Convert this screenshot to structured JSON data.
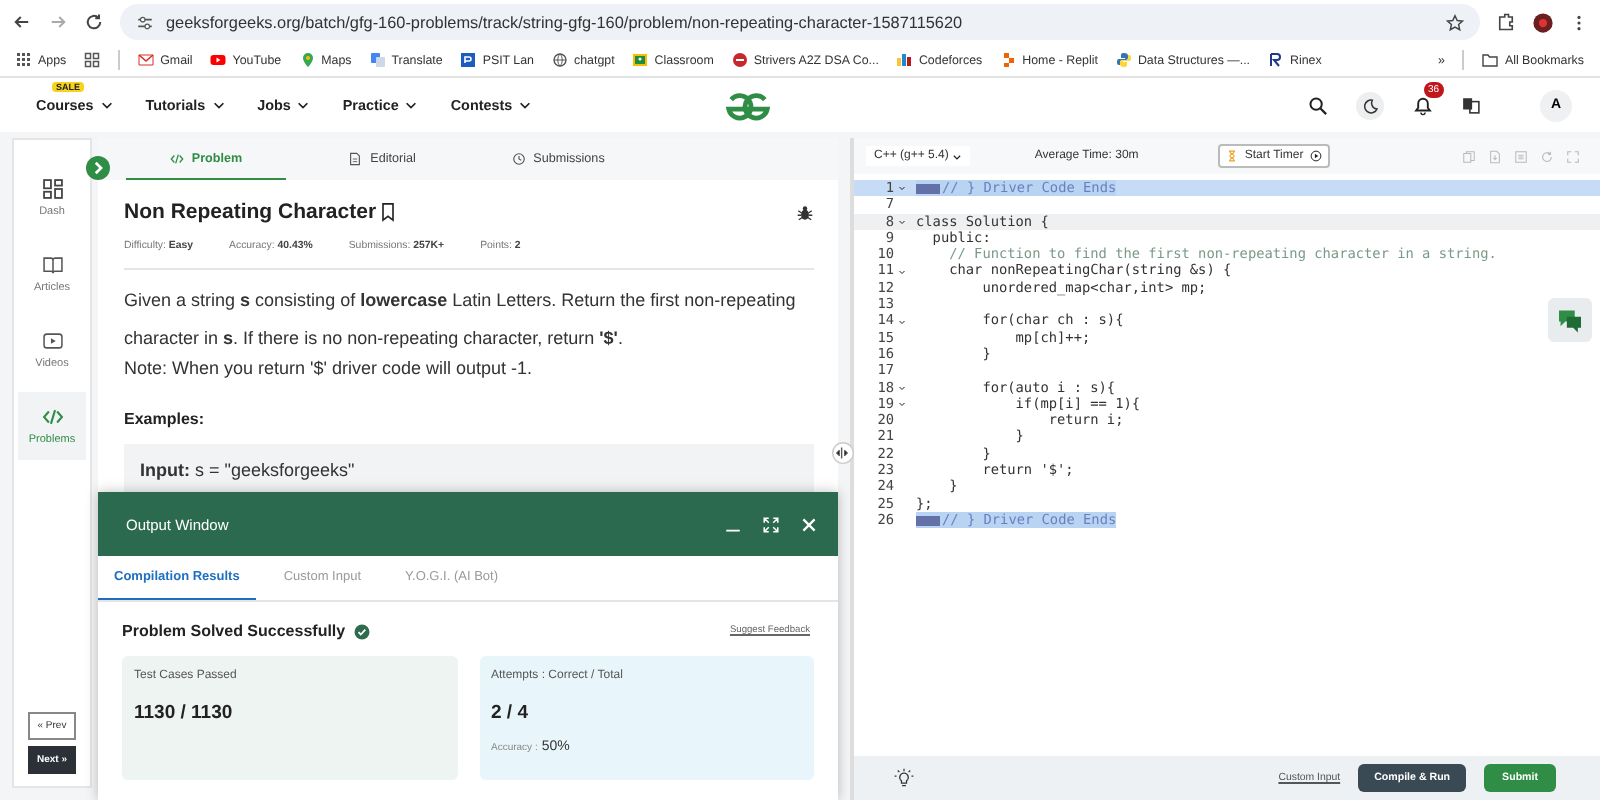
{
  "browser": {
    "url": "geeksforgeeks.org/batch/gfg-160-problems/track/string-gfg-160/problem/non-repeating-character-1587115620",
    "bookmarks": [
      {
        "label": "Apps"
      },
      {
        "label": "Gmail"
      },
      {
        "label": "YouTube"
      },
      {
        "label": "Maps"
      },
      {
        "label": "Translate"
      },
      {
        "label": "PSIT Lan"
      },
      {
        "label": "chatgpt"
      },
      {
        "label": "Classroom"
      },
      {
        "label": "Strivers A2Z DSA Co..."
      },
      {
        "label": "Codeforces"
      },
      {
        "label": "Home - Replit"
      },
      {
        "label": "Data Structures —..."
      },
      {
        "label": "Rinex"
      }
    ],
    "more": "»",
    "all_bookmarks": "All Bookmarks"
  },
  "header": {
    "nav": [
      {
        "label": "Courses",
        "badge": "SALE"
      },
      {
        "label": "Tutorials"
      },
      {
        "label": "Jobs"
      },
      {
        "label": "Practice"
      },
      {
        "label": "Contests"
      }
    ],
    "notifications": "36",
    "avatar": "A"
  },
  "sidebar": {
    "items": [
      {
        "label": "Dash",
        "selected": false
      },
      {
        "label": "Articles",
        "selected": false
      },
      {
        "label": "Videos",
        "selected": false
      },
      {
        "label": "Problems",
        "selected": true
      }
    ],
    "prev": "« Prev",
    "next": "Next »"
  },
  "problem": {
    "tabs": [
      {
        "label": "Problem",
        "selected": true
      },
      {
        "label": "Editorial",
        "selected": false
      },
      {
        "label": "Submissions",
        "selected": false
      }
    ],
    "title": "Non Repeating Character",
    "meta": [
      {
        "label": "Difficulty: ",
        "value": "Easy"
      },
      {
        "label": "Accuracy: ",
        "value": "40.43%"
      },
      {
        "label": "Submissions: ",
        "value": "257K+"
      },
      {
        "label": "Points: ",
        "value": "2"
      }
    ],
    "description": "Given a string **s** consisting of **lowercase** Latin Letters. Return the first non-repeating character in **s**. If there is no non-repeating character, return **'$'**.",
    "note": "Note: When you return '$' driver code will output -1.",
    "examples_heading": "Examples:",
    "example_input": "**Input:** s = \"geeksforgeeks\""
  },
  "output": {
    "title": "Output Window",
    "tabs": [
      {
        "label": "Compilation Results",
        "selected": true
      },
      {
        "label": "Custom Input",
        "selected": false
      },
      {
        "label": "Y.O.G.I. (AI Bot)",
        "selected": false
      }
    ],
    "status": "Problem Solved Successfully",
    "feedback": "Suggest Feedback",
    "cards": [
      {
        "label": "Test Cases Passed",
        "value": "1130 / 1130",
        "color": "#eef4f2"
      },
      {
        "label": "Attempts : Correct / Total",
        "value": "2 / 4",
        "sub_label": "Accuracy : ",
        "sub_value": "50%",
        "color": "#e8f6fb"
      }
    ]
  },
  "editor": {
    "language": "C++ (g++ 5.4)",
    "average_time": "Average Time: 30m",
    "timer": "Start Timer",
    "lines": [
      {
        "number": "1",
        "text": "// } Driver Code Ends",
        "kind": "driver",
        "foldable": true
      },
      {
        "number": "7",
        "kind": "code",
        "foldable": false
      },
      {
        "number": "8",
        "text": "class Solution {",
        "kind": "active",
        "foldable": true
      },
      {
        "number": "9",
        "text": "  public:",
        "kind": "code",
        "foldable": false
      },
      {
        "number": "10",
        "text": "    // Function to find the first non-repeating character in a string.",
        "kind": "comment",
        "foldable": false
      },
      {
        "number": "11",
        "text": "    char nonRepeatingChar(string &s) {",
        "kind": "code",
        "foldable": true
      },
      {
        "number": "12",
        "text": "        unordered_map<char,int> mp;",
        "kind": "code",
        "foldable": false
      },
      {
        "number": "13",
        "kind": "code",
        "foldable": false
      },
      {
        "number": "14",
        "text": "        for(char ch : s){",
        "kind": "code",
        "foldable": true
      },
      {
        "number": "15",
        "text": "            mp[ch]++;",
        "kind": "code",
        "foldable": false
      },
      {
        "number": "16",
        "text": "        }",
        "kind": "code",
        "foldable": false
      },
      {
        "number": "17",
        "kind": "code",
        "foldable": false
      },
      {
        "number": "18",
        "text": "        for(auto i : s){",
        "kind": "code",
        "foldable": true
      },
      {
        "number": "19",
        "text": "            if(mp[i] == 1){",
        "kind": "code",
        "foldable": true
      },
      {
        "number": "20",
        "text": "                return i;",
        "kind": "code",
        "foldable": false
      },
      {
        "number": "21",
        "text": "            }",
        "kind": "code",
        "foldable": false
      },
      {
        "number": "22",
        "text": "        }",
        "kind": "code",
        "foldable": false
      },
      {
        "number": "23",
        "text": "        return '$';",
        "kind": "code",
        "foldable": false
      },
      {
        "number": "24",
        "text": "    }",
        "kind": "code",
        "foldable": false
      },
      {
        "number": "25",
        "text": "};",
        "kind": "code",
        "foldable": false
      },
      {
        "number": "26",
        "text": "// } Driver Code Ends",
        "kind": "driver",
        "foldable": false
      }
    ],
    "custom_input": "Custom Input",
    "compile": "Compile & Run",
    "submit": "Submit"
  }
}
